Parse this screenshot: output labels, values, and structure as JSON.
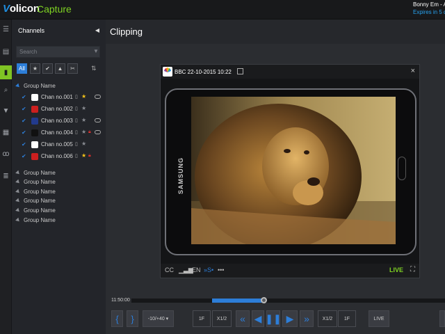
{
  "app": {
    "logo_text": "olicon",
    "logo_v": "V",
    "product": "Capture"
  },
  "user": {
    "name": "Bonny Em - A",
    "expires": "Expires in 5 da"
  },
  "rail_icons": [
    "menu-icon",
    "film-icon",
    "phone-icon",
    "search-icon",
    "bookmark-icon",
    "calendar-icon",
    "voicemail-icon",
    "list-icon"
  ],
  "panel": {
    "title": "Channels",
    "search_placeholder": "Search",
    "filter_all_label": "All",
    "groups_top": "Group Name",
    "channels": [
      {
        "name": "Chan no.001",
        "logo": "nbc",
        "fav": true,
        "lock": false,
        "toggle": true
      },
      {
        "name": "Chan no.002",
        "logo": "cnn",
        "fav": false,
        "lock": false,
        "toggle": false
      },
      {
        "name": "Chan no.003",
        "logo": "fox",
        "fav": false,
        "lock": false,
        "toggle": true
      },
      {
        "name": "Chan no.004",
        "logo": "bbc",
        "fav": false,
        "lock": true,
        "toggle": true
      },
      {
        "name": "Chan no.005",
        "logo": "nbc",
        "fav": false,
        "lock": false,
        "toggle": false
      },
      {
        "name": "Chan no.006",
        "logo": "cnn",
        "fav": true,
        "lock": true,
        "toggle": false
      }
    ],
    "groups_bottom": [
      "Group Name",
      "Group Name",
      "Group Name",
      "Group Name",
      "Group Name",
      "Group Name"
    ]
  },
  "main": {
    "title": "Clipping"
  },
  "player": {
    "title": "BBC  22-10-2015 10:22",
    "controls": {
      "cc": "CC",
      "lang": "EN",
      "subtitle": "»S•",
      "more": "•••",
      "live": "LIVE"
    },
    "phone_brand": "SAMSUNG"
  },
  "timeline": {
    "time": "11:50:00"
  },
  "buttons": {
    "minus10": "-10/+40",
    "f1_left": "1F",
    "x12_left": "X1/2",
    "x12_right": "X1/2",
    "f1_right": "1F",
    "live": "LIVE"
  },
  "colors": {
    "accent_green": "#7fd322",
    "accent_blue": "#2d7ed8",
    "fav_star": "#f4c319",
    "lock_red": "#e0312e"
  }
}
